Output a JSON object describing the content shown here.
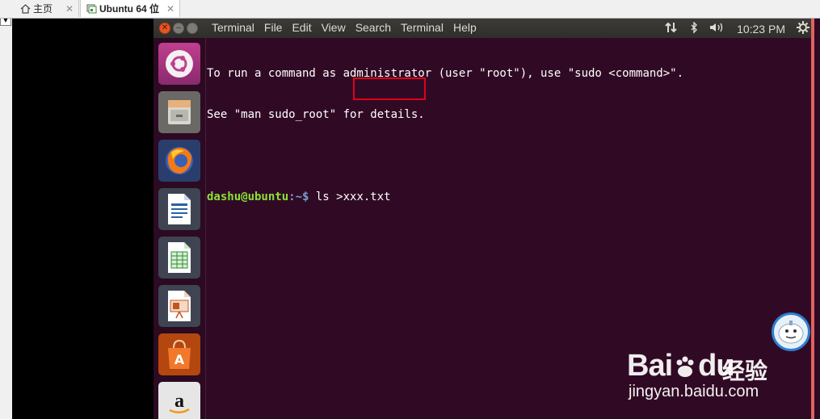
{
  "host": {
    "tabs": [
      {
        "label": "主页",
        "icon": "home-icon"
      },
      {
        "label": "Ubuntu 64 位",
        "icon": "vm-icon",
        "active": true
      }
    ],
    "close_glyph": "✕"
  },
  "ubuntu": {
    "menus": [
      "Terminal",
      "File",
      "Edit",
      "View",
      "Search",
      "Terminal",
      "Help"
    ],
    "clock": "10:23 PM",
    "indicators": [
      "network-icon",
      "bluetooth-icon",
      "volume-icon",
      "settings-gear-icon"
    ]
  },
  "launcher": {
    "items": [
      "ubuntu-dash-icon",
      "files-icon",
      "firefox-icon",
      "libreoffice-writer-icon",
      "libreoffice-calc-icon",
      "libreoffice-impress-icon",
      "software-center-icon",
      "amazon-icon"
    ]
  },
  "terminal": {
    "lines": [
      "To run a command as administrator (user \"root\"), use \"sudo <command>\".",
      "See \"man sudo_root\" for details."
    ],
    "prompt_user": "dashu@ubuntu",
    "prompt_path": ":~$",
    "command": " ls >xxx.txt"
  },
  "watermark": {
    "logo_left": "Bai",
    "logo_right": "du",
    "chinese": "经验",
    "url": "jingyan.baidu.com"
  },
  "colors": {
    "terminal_bg": "#300a24",
    "prompt_user": "#8ae234",
    "prompt_path": "#729fcf",
    "highlight_box": "#e0001b",
    "ubuntu_orange": "#e95420"
  }
}
